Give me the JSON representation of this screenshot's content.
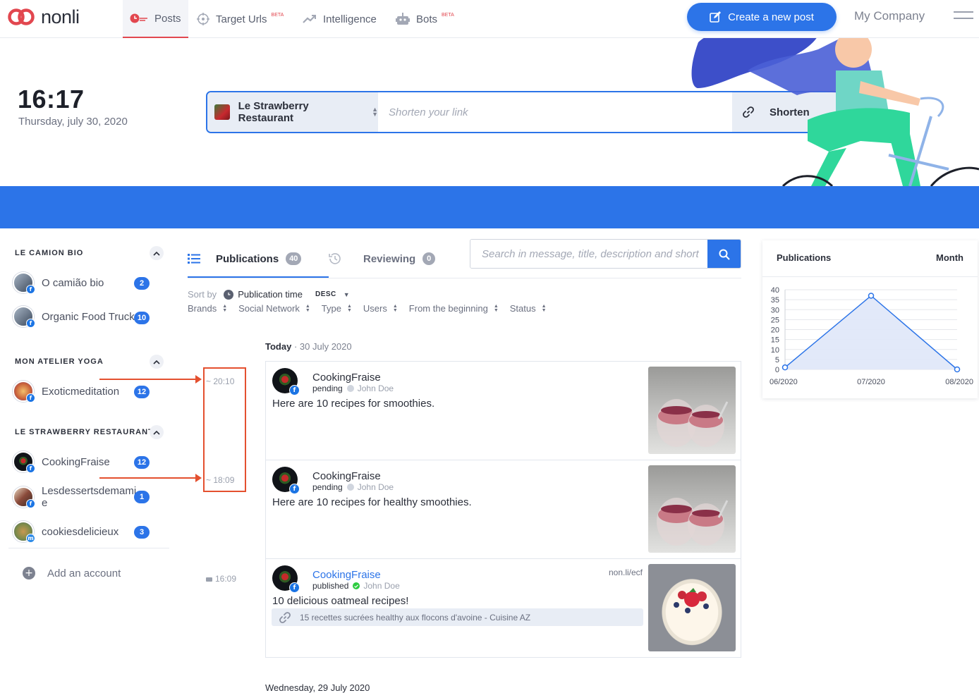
{
  "app": {
    "logo_text": "nonli"
  },
  "nav": {
    "items": [
      {
        "label": "Posts",
        "icon": "clock-icon",
        "active": true
      },
      {
        "label": "Target Urls",
        "icon": "crosshair-icon",
        "badge": "BETA"
      },
      {
        "label": "Intelligence",
        "icon": "trend-icon"
      },
      {
        "label": "Bots",
        "icon": "robot-icon",
        "badge": "BETA"
      }
    ],
    "create_label": "Create a new post",
    "company_label": "My Company"
  },
  "header": {
    "clock": "16:17",
    "date": "Thursday, july 30, 2020",
    "shortener": {
      "brand": "Le Strawberry Restaurant",
      "placeholder": "Shorten your link",
      "button": "Shorten"
    }
  },
  "sidebar": {
    "groups": [
      {
        "title": "LE CAMION BIO",
        "accounts": [
          {
            "name": "O camião bio",
            "count": "2"
          },
          {
            "name": "Organic Food Truck",
            "count": "10"
          }
        ]
      },
      {
        "title": "MON ATELIER YOGA",
        "accounts": [
          {
            "name": "Exoticmeditation",
            "count": "12"
          }
        ]
      },
      {
        "title": "LE STRAWBERRY RESTAURANT",
        "accounts": [
          {
            "name": "CookingFraise",
            "count": "12"
          },
          {
            "name": "Lesdessertsdemamie",
            "count": "1"
          },
          {
            "name": "cookiesdelicieux",
            "count": "3"
          }
        ]
      }
    ],
    "add_account": "Add an account"
  },
  "main": {
    "tabs": [
      {
        "label": "Publications",
        "count": "40"
      },
      {
        "label": "Reviewing",
        "count": "0"
      }
    ],
    "search_placeholder": "Search in message, title, description and short",
    "sort": {
      "label": "Sort by",
      "field": "Publication time",
      "order": "DESC"
    },
    "filters": [
      "Brands",
      "Social Network",
      "Type",
      "Users",
      "From the beginning",
      "Status"
    ],
    "day": {
      "label": "Today",
      "date": "30 July 2020"
    },
    "next_day": "Wednesday, 29 July 2020",
    "posts": [
      {
        "time": "20:10",
        "account": "CookingFraise",
        "status": "pending",
        "author": "John Doe",
        "message": "Here are 10 recipes for smoothies."
      },
      {
        "time": "18:09",
        "account": "CookingFraise",
        "status": "pending",
        "author": "John Doe",
        "message": "Here are 10 recipes for healthy smoothies."
      },
      {
        "time": "16:09",
        "account": "CookingFraise",
        "status": "published",
        "author": "John Doe",
        "message": "10 delicious oatmeal recipes!",
        "short_url": "non.li/ecf",
        "link_title": "15 recettes sucrées healthy aux flocons d'avoine - Cuisine AZ"
      }
    ]
  },
  "widget": {
    "title": "Publications",
    "period": "Month"
  },
  "chart_data": {
    "type": "area",
    "title": "Publications",
    "categories": [
      "06/2020",
      "07/2020",
      "08/2020"
    ],
    "series": [
      {
        "values": [
          1,
          37,
          0
        ]
      }
    ],
    "ylim": [
      0,
      40
    ],
    "yticks": [
      0,
      5,
      10,
      15,
      20,
      25,
      30,
      35,
      40
    ],
    "grid": true
  },
  "colors": {
    "primary": "#2c74e8",
    "brand_red": "#e2474f",
    "annotation": "#e4502f",
    "published": "#2ecc40"
  }
}
